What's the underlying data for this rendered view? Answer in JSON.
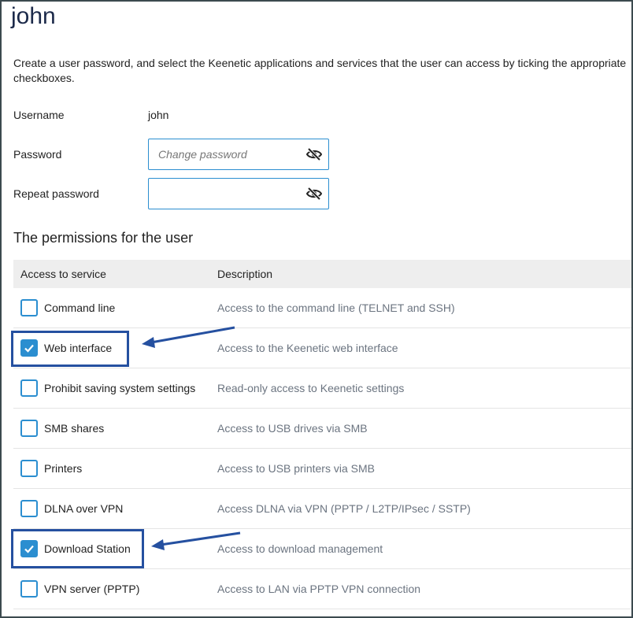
{
  "page": {
    "title": "john",
    "intro": "Create a user password, and select the Keenetic applications and services that the user can access by ticking the appropriate checkboxes."
  },
  "form": {
    "username_label": "Username",
    "username_value": "john",
    "password_label": "Password",
    "password_placeholder": "Change password",
    "repeat_label": "Repeat password",
    "repeat_placeholder": ""
  },
  "permissions": {
    "title": "The permissions for the user",
    "headers": {
      "service": "Access to service",
      "description": "Description"
    },
    "rows": [
      {
        "name": "Command line",
        "description": "Access to the command line (TELNET and SSH)",
        "checked": false
      },
      {
        "name": "Web interface",
        "description": "Access to the Keenetic web interface",
        "checked": true
      },
      {
        "name": "Prohibit saving system settings",
        "description": "Read-only access to Keenetic settings",
        "checked": false
      },
      {
        "name": "SMB shares",
        "description": "Access to USB drives via SMB",
        "checked": false
      },
      {
        "name": "Printers",
        "description": "Access to USB printers via SMB",
        "checked": false
      },
      {
        "name": "DLNA over VPN",
        "description": "Access DLNA via VPN (PPTP / L2TP/IPsec / SSTP)",
        "checked": false
      },
      {
        "name": "Download Station",
        "description": "Access to download management",
        "checked": true
      },
      {
        "name": "VPN server (PPTP)",
        "description": "Access to LAN via PPTP VPN connection",
        "checked": false
      }
    ]
  },
  "colors": {
    "accent": "#2b8ed0",
    "annotation": "#2550a0",
    "title": "#1c2a4a"
  },
  "icons": {
    "password_toggle": "eye-off-icon",
    "checkmark": "checkmark-icon",
    "annotation_arrow": "arrow-icon"
  }
}
